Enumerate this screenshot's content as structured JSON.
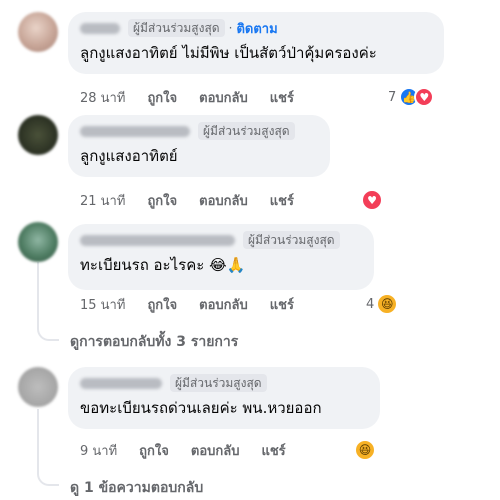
{
  "comments": [
    {
      "badge": "ผู้มีส่วนร่วมสูงสุด",
      "separator": "·",
      "follow_label": "ติดตาม",
      "text": "ลูกงูแสงอาทิตย์ ไม่มีพิษ เป็นสัตว์ป่าคุ้มครองค่ะ",
      "time": "28 นาที",
      "like_label": "ถูกใจ",
      "reply_label": "ตอบกลับ",
      "share_label": "แชร์",
      "reaction_count": "7",
      "reactions": [
        "like-icon",
        "love-icon"
      ]
    },
    {
      "badge": "ผู้มีส่วนร่วมสูงสุด",
      "text": "ลูกงูแสงอาทิตย์",
      "time": "21 นาที",
      "like_label": "ถูกใจ",
      "reply_label": "ตอบกลับ",
      "share_label": "แชร์",
      "reactions": [
        "love-icon"
      ]
    },
    {
      "badge": "ผู้มีส่วนร่วมสูงสุด",
      "text": "ทะเบียนรถ อะไรคะ 😂🙏",
      "time": "15 นาที",
      "like_label": "ถูกใจ",
      "reply_label": "ตอบกลับ",
      "share_label": "แชร์",
      "reaction_count": "4",
      "reactions": [
        "haha-icon"
      ],
      "view_replies": "ดูการตอบกลับทั้ง 3 รายการ"
    },
    {
      "badge": "ผู้มีส่วนร่วมสูงสุด",
      "text": "ขอทะเบียนรถด่วนเลยค่ะ พน.หวยออก",
      "time": "9 นาที",
      "like_label": "ถูกใจ",
      "reply_label": "ตอบกลับ",
      "share_label": "แชร์",
      "reactions": [
        "haha-icon"
      ],
      "view_replies": "ดู 1 ข้อความตอบกลับ"
    }
  ],
  "colors": {
    "bubble": "#f0f2f5",
    "accent": "#1877f2",
    "love": "#f33e58",
    "haha": "#f7b125",
    "muted": "#65676b"
  }
}
